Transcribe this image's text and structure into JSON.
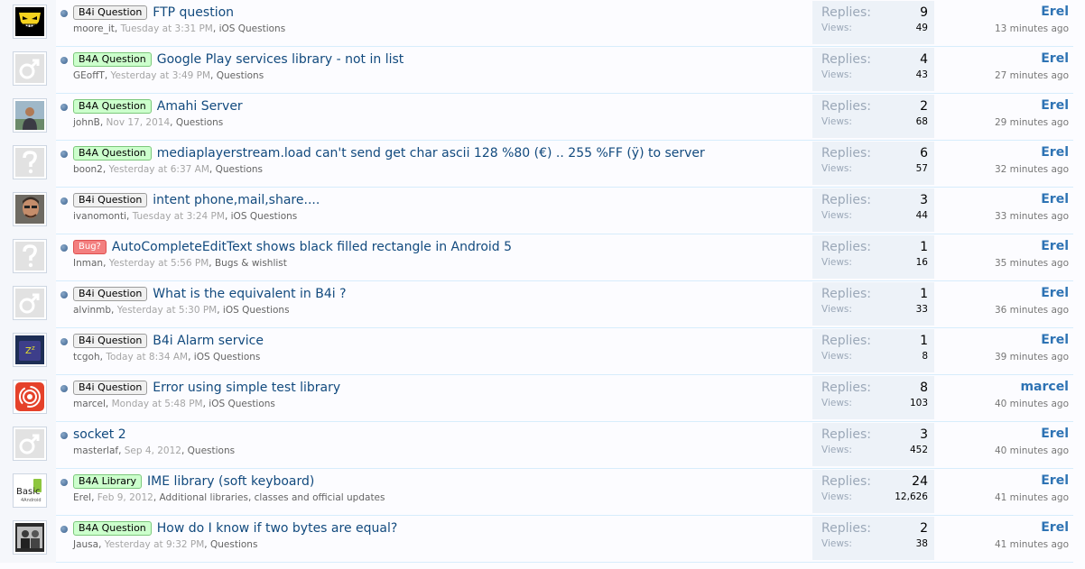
{
  "threads": [
    {
      "prefix": "B4i Question",
      "prefix_style": "grey",
      "title": "FTP question",
      "author": "moore_it",
      "date": "Tuesday at 3:31 PM",
      "forum": "iOS Questions",
      "replies": "9",
      "views": "49",
      "last_user": "Erel",
      "last_time": "13 minutes ago",
      "avatar": "avatar-cartoon-face"
    },
    {
      "prefix": "B4A Question",
      "prefix_style": "green",
      "title": "Google Play services library - not in list",
      "author": "GEoffT",
      "date": "Yesterday at 3:49 PM",
      "forum": "Questions",
      "replies": "4",
      "views": "43",
      "last_user": "Erel",
      "last_time": "27 minutes ago",
      "avatar": "avatar-default-male"
    },
    {
      "prefix": "B4A Question",
      "prefix_style": "green",
      "title": "Amahi Server",
      "author": "johnB",
      "date": "Nov 17, 2014",
      "forum": "Questions",
      "replies": "2",
      "views": "68",
      "last_user": "Erel",
      "last_time": "29 minutes ago",
      "avatar": "avatar-photo-person"
    },
    {
      "prefix": "B4A Question",
      "prefix_style": "green",
      "title": "mediaplayerstream.load can't send get char ascii 128 %80 (€) .. 255 %FF (ÿ) to server",
      "author": "boon2",
      "date": "Yesterday at 6:37 AM",
      "forum": "Questions",
      "replies": "6",
      "views": "57",
      "last_user": "Erel",
      "last_time": "32 minutes ago",
      "avatar": "avatar-default-unknown"
    },
    {
      "prefix": "B4i Question",
      "prefix_style": "grey",
      "title": "intent phone,mail,share....",
      "author": "ivanomonti",
      "date": "Tuesday at 3:24 PM",
      "forum": "iOS Questions",
      "replies": "3",
      "views": "44",
      "last_user": "Erel",
      "last_time": "33 minutes ago",
      "avatar": "avatar-photo-face"
    },
    {
      "prefix": "Bug?",
      "prefix_style": "red",
      "title": "AutoCompleteEditText shows black filled rectangle in Android 5",
      "author": "Inman",
      "date": "Yesterday at 5:56 PM",
      "forum": "Bugs & wishlist",
      "replies": "1",
      "views": "16",
      "last_user": "Erel",
      "last_time": "35 minutes ago",
      "avatar": "avatar-default-unknown"
    },
    {
      "prefix": "B4i Question",
      "prefix_style": "grey",
      "title": "What is the equivalent in B4i ?",
      "author": "alvinmb",
      "date": "Yesterday at 5:30 PM",
      "forum": "iOS Questions",
      "replies": "1",
      "views": "33",
      "last_user": "Erel",
      "last_time": "36 minutes ago",
      "avatar": "avatar-default-male"
    },
    {
      "prefix": "B4i Question",
      "prefix_style": "grey",
      "title": "B4i Alarm service",
      "author": "tcgoh",
      "date": "Today at 8:34 AM",
      "forum": "iOS Questions",
      "replies": "1",
      "views": "8",
      "last_user": "Erel",
      "last_time": "39 minutes ago",
      "avatar": "avatar-sleep-icon"
    },
    {
      "prefix": "B4i Question",
      "prefix_style": "grey",
      "title": "Error using simple test library",
      "author": "marcel",
      "date": "Monday at 5:48 PM",
      "forum": "iOS Questions",
      "replies": "8",
      "views": "103",
      "last_user": "marcel",
      "last_time": "40 minutes ago",
      "avatar": "avatar-red-signal"
    },
    {
      "prefix": "",
      "prefix_style": "none",
      "title": "socket 2",
      "author": "masterlaf",
      "date": "Sep 4, 2012",
      "forum": "Questions",
      "replies": "3",
      "views": "452",
      "last_user": "Erel",
      "last_time": "40 minutes ago",
      "avatar": "avatar-default-male"
    },
    {
      "prefix": "B4A Library",
      "prefix_style": "green",
      "title": "IME library (soft keyboard)",
      "author": "Erel",
      "date": "Feb 9, 2012",
      "forum": "Additional libraries, classes and official updates",
      "replies": "24",
      "views": "12,626",
      "last_user": "Erel",
      "last_time": "41 minutes ago",
      "avatar": "avatar-basic4android-logo"
    },
    {
      "prefix": "B4A Question",
      "prefix_style": "green",
      "title": "How do I know if two bytes are equal?",
      "author": "Jausa",
      "date": "Yesterday at 9:32 PM",
      "forum": "Questions",
      "replies": "2",
      "views": "38",
      "last_user": "Erel",
      "last_time": "41 minutes ago",
      "avatar": "avatar-photo-group"
    }
  ],
  "labels": {
    "replies": "Replies:",
    "views": "Views:",
    "separator": ", ",
    "basic_logo_text": "Basic",
    "basic_logo_sub": "4Android"
  }
}
